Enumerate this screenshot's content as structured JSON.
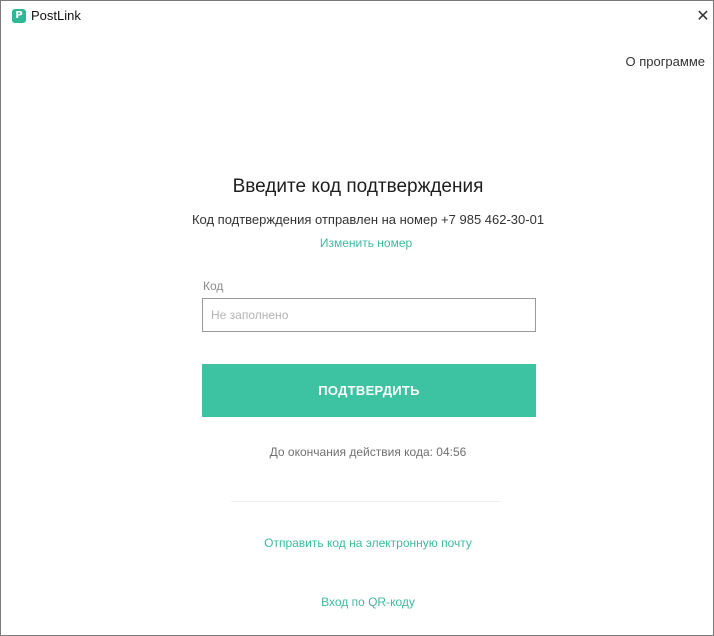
{
  "window": {
    "app_title": "PostLink",
    "app_icon": "postlink-logo-icon",
    "close_glyph": "✕",
    "accent_color": "#3dc3a2"
  },
  "header": {
    "about_label": "О программе"
  },
  "main": {
    "heading": "Введите код подтверждения",
    "sent_text": "Код подтверждения отправлен на номер +7  985 462-30-01",
    "change_number_label": "Изменить номер",
    "code_label": "Код",
    "code_value": "",
    "code_placeholder": "Не заполнено",
    "confirm_label": "ПОДТВЕРДИТЬ",
    "timer_text": "До окончания действия кода: 04:56",
    "email_link_label": "Отправить код на электронную почту",
    "qr_link_label": "Вход по QR-коду"
  }
}
